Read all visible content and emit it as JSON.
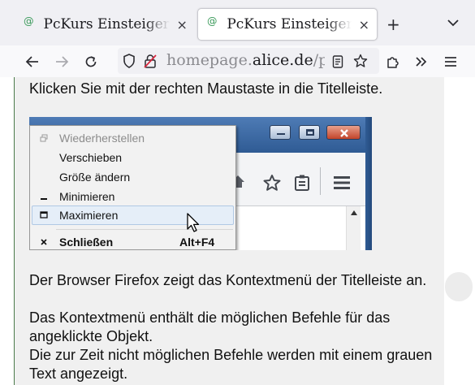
{
  "tabs": [
    {
      "title": "PcKurs Einsteiger – Kontextmenü",
      "active": false,
      "close_glyph": "×"
    },
    {
      "title": "PcKurs Einsteiger – Kontextmenü",
      "active": true,
      "close_glyph": "×"
    }
  ],
  "tabstrip": {
    "new_tab_glyph": "+"
  },
  "navbar": {
    "url_prefix": "homepage.",
    "url_domain": "alice.de",
    "url_path": "/pckurs"
  },
  "content": {
    "intro": "Klicken Sie mit der rechten Maustaste in die Titelleiste.",
    "para1": "Der Browser Firefox zeigt das Kontextmenü der Titelleiste an.",
    "para2": "Das Kontextmenü enthält die möglichen Befehle für das angeklickte Objekt.",
    "para3": "Die zur Zeit nicht möglichen Befehle werden mit einem grauen Text angezeigt."
  },
  "screenshot": {
    "menu_items": [
      {
        "label": "Wiederherstellen",
        "state": "disabled",
        "icon": "restore-icon"
      },
      {
        "label": "Verschieben",
        "state": "enabled",
        "icon": ""
      },
      {
        "label": "Größe ändern",
        "state": "enabled",
        "icon": ""
      },
      {
        "label": "Minimieren",
        "state": "enabled",
        "icon": "minimize-icon"
      },
      {
        "label": "Maximieren",
        "state": "hover",
        "icon": "maximize-icon"
      },
      {
        "label": "Schließen",
        "state": "bold",
        "icon": "close-icon",
        "accelerator": "Alt+F4"
      }
    ]
  },
  "colors": {
    "tabstrip_bg": "#f0f0f4",
    "content_bg": "#f0f0f0",
    "titlebar_blue": "#3d6aa6",
    "close_red": "#c2442a"
  }
}
